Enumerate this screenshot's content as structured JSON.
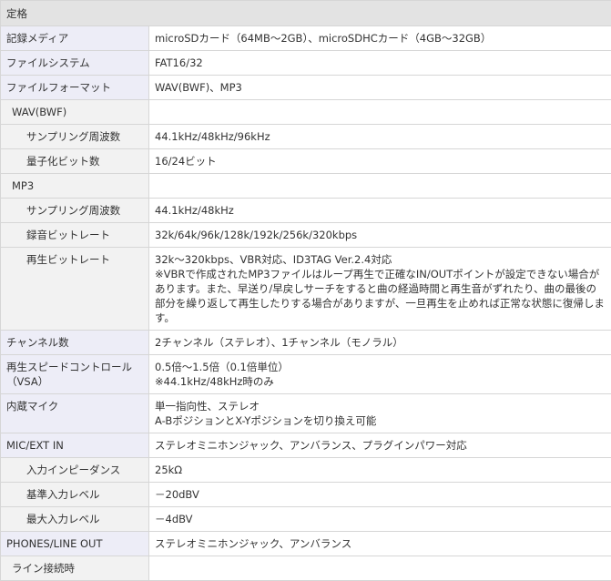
{
  "header": "定格",
  "rows": [
    {
      "label": "記録メディア",
      "value": "microSDカード（64MB〜2GB）、microSDHCカード（4GB〜32GB）"
    },
    {
      "label": "ファイルシステム",
      "value": "FAT16/32"
    },
    {
      "label": "ファイルフォーマット",
      "value": "WAV(BWF)、MP3"
    },
    {
      "label": "WAV(BWF)",
      "value": ""
    },
    {
      "label": "サンプリング周波数",
      "value": "44.1kHz/48kHz/96kHz"
    },
    {
      "label": "量子化ビット数",
      "value": "16/24ビット"
    },
    {
      "label": "MP3",
      "value": ""
    },
    {
      "label": "サンプリング周波数",
      "value": "44.1kHz/48kHz"
    },
    {
      "label": "録音ビットレート",
      "value": "32k/64k/96k/128k/192k/256k/320kbps"
    },
    {
      "label": "再生ビットレート",
      "value": "32k〜320kbps、VBR対応、ID3TAG Ver.2.4対応",
      "note": "※VBRで作成されたMP3ファイルはループ再生で正確なIN/OUTポイントが設定できない場合があります。また、早送り/早戻しサーチをすると曲の経過時間と再生音がずれたり、曲の最後の部分を繰り返して再生したりする場合がありますが、一旦再生を止めれば正常な状態に復帰します。"
    },
    {
      "label": "チャンネル数",
      "value": "2チャンネル（ステレオ）、1チャンネル（モノラル）"
    },
    {
      "label": "再生スピードコントロール",
      "label2": "（VSA）",
      "value": "0.5倍〜1.5倍（0.1倍単位）",
      "value2": "※44.1kHz/48kHz時のみ"
    },
    {
      "label": "内蔵マイク",
      "value": "単一指向性、ステレオ",
      "value2": "A-BポジションとX-Yポジションを切り換え可能"
    },
    {
      "label": "MIC/EXT IN",
      "value": "ステレオミニホンジャック、アンバランス、プラグインパワー対応"
    },
    {
      "label": "入力インピーダンス",
      "value": "25kΩ"
    },
    {
      "label": "基準入力レベル",
      "value": "－20dBV"
    },
    {
      "label": "最大入力レベル",
      "value": "－4dBV"
    },
    {
      "label": "PHONES/LINE OUT",
      "value": "ステレオミニホンジャック、アンバランス"
    },
    {
      "label": "ライン接続時",
      "value": ""
    }
  ]
}
